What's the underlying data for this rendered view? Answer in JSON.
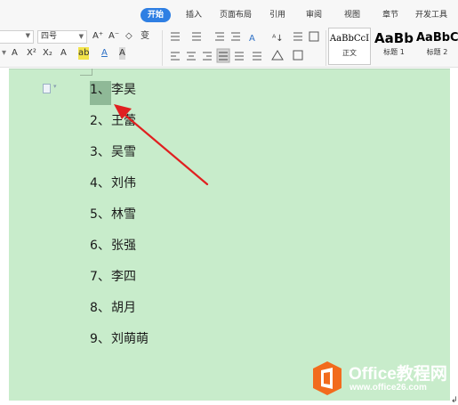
{
  "ribbon": {
    "tabs": [
      {
        "label": "开始",
        "active": true
      },
      {
        "label": "插入"
      },
      {
        "label": "页面布局"
      },
      {
        "label": "引用"
      },
      {
        "label": "审阅"
      },
      {
        "label": "视图"
      },
      {
        "label": "章节"
      },
      {
        "label": "开发工具"
      }
    ]
  },
  "toolbar": {
    "font_size": "四号",
    "row1_icons": [
      "A⁺",
      "A⁻",
      "◇",
      "变"
    ],
    "row2_icons": [
      "A",
      "X²",
      "X₂",
      "A",
      "ab",
      "A",
      "A"
    ],
    "styles": [
      {
        "preview": "AaBbCcI",
        "label": "正文"
      },
      {
        "preview": "AaBb",
        "label": "标题 1"
      },
      {
        "preview": "AaBbC",
        "label": "标题 2"
      }
    ]
  },
  "document": {
    "items": [
      {
        "num": "1、",
        "text": "李昊"
      },
      {
        "num": "2、",
        "text": "王蕾"
      },
      {
        "num": "3、",
        "text": "吴雪"
      },
      {
        "num": "4、",
        "text": "刘伟"
      },
      {
        "num": "5、",
        "text": "林雪"
      },
      {
        "num": "6、",
        "text": "张强"
      },
      {
        "num": "7、",
        "text": "李四"
      },
      {
        "num": "8、",
        "text": "胡月"
      },
      {
        "num": "9、",
        "text": "刘萌萌"
      }
    ]
  },
  "watermark": {
    "title": "Office教程网",
    "url": "www.office26.com"
  },
  "colors": {
    "doc_background": "#c8eccb",
    "selection": "#8fb997",
    "arrow": "#e02020",
    "active_tab": "#2f7fe3",
    "logo_orange": "#f26b1d"
  },
  "icons": [
    "doc-icon",
    "font-grow-icon",
    "font-shrink-icon",
    "clear-format-icon",
    "bullet-list-icon",
    "numbered-list-icon",
    "office-logo-icon",
    "red-arrow-icon"
  ]
}
